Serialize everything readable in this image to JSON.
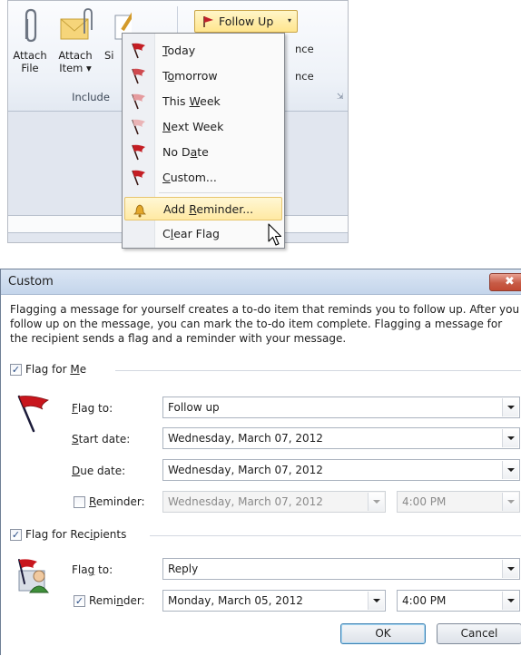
{
  "ribbon": {
    "attach_file": [
      "Attach",
      "File"
    ],
    "attach_item": [
      "Attach",
      "Item ▾"
    ],
    "signature_partial": "Si",
    "group_label": "Include",
    "partial_right_1": "nce",
    "partial_right_2": "nce",
    "follow_up": {
      "label": "Follow Up",
      "arrow": "▾",
      "flag_color": "#c0202a"
    }
  },
  "menu": {
    "items": [
      {
        "label": "Today",
        "u": 0,
        "flag": "#c41e24"
      },
      {
        "label": "Tomorrow",
        "u": 1,
        "flag": "#cf4a4f"
      },
      {
        "label": "This Week",
        "u": 5,
        "flag": "#e59b9e"
      },
      {
        "label": "Next Week",
        "u": 0,
        "flag": "#eab4b6"
      },
      {
        "label": "No Date",
        "u": 4,
        "flag": "#c41e24"
      },
      {
        "label": "Custom...",
        "u": 0,
        "flag": "#c41e24"
      },
      {
        "label": "Add Reminder...",
        "u": 4,
        "icon": "bell"
      },
      {
        "label": "Clear Flag",
        "u": 1,
        "icon": "none"
      }
    ]
  },
  "dialog": {
    "title": "Custom",
    "close_glyph": "✖",
    "description": "Flagging a message for yourself creates a to-do item that reminds you to follow up. After you follow up on the message, you can mark the to-do item complete. Flagging a message for the recipient sends a flag and a reminder with your message.",
    "flag_for_me": {
      "label": "Flag for Me",
      "u": 9,
      "checked": true,
      "flag_to": {
        "label": "Flag to:",
        "u": 0,
        "value": "Follow up"
      },
      "start_date": {
        "label": "Start date:",
        "u": 0,
        "value": "Wednesday, March 07, 2012"
      },
      "due_date": {
        "label": "Due date:",
        "u": 0,
        "value": "Wednesday, March 07, 2012"
      },
      "reminder": {
        "label": "Reminder:",
        "u": 0,
        "checked": false,
        "date": "Wednesday, March 07, 2012",
        "time": "4:00 PM"
      }
    },
    "flag_for_recipients": {
      "label": "Flag for Recipients",
      "u": 12,
      "checked": true,
      "flag_to": {
        "label": "Flag to:",
        "u": 3,
        "value": "Reply"
      },
      "reminder": {
        "label": "Reminder:",
        "u": 4,
        "checked": true,
        "date": "Monday, March 05, 2012",
        "time": "4:00 PM"
      }
    },
    "ok_label": "OK",
    "cancel_label": "Cancel",
    "check_glyph": "✓"
  }
}
